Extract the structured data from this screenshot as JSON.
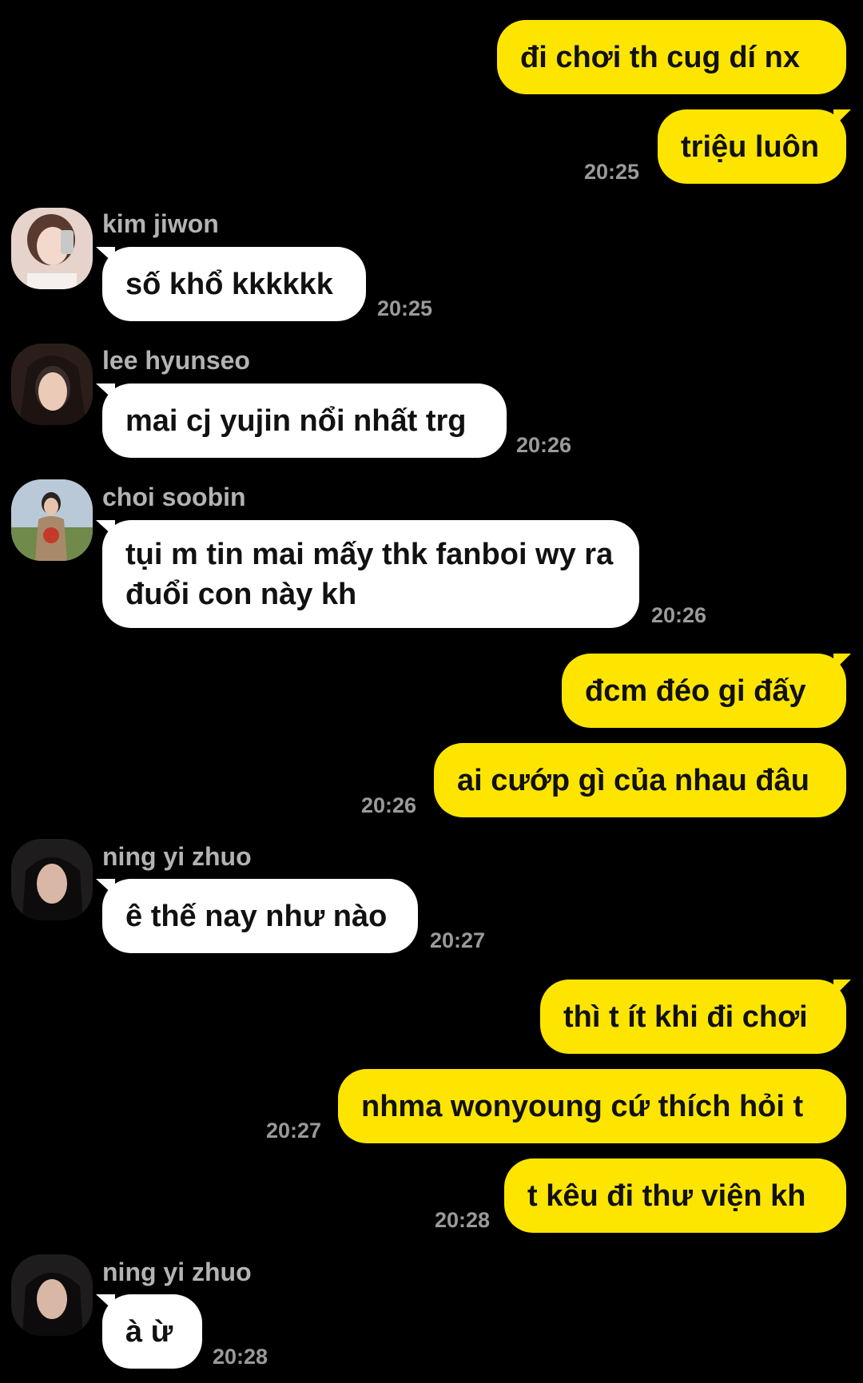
{
  "messages": [
    {
      "from": "me",
      "text": "đi chơi th cug dí nx"
    },
    {
      "from": "me",
      "text": "triệu luôn",
      "time": "20:25"
    },
    {
      "from": "kim jiwon",
      "sender": "kim jiwon",
      "text": "số khổ kkkkkk",
      "time": "20:25"
    },
    {
      "from": "lee hyunseo",
      "sender": "lee hyunseo",
      "text": "mai cj yujin nổi nhất trg",
      "time": "20:26"
    },
    {
      "from": "choi soobin",
      "sender": "choi soobin",
      "text": "tụi m tin mai mấy thk fanboi wy ra đuổi con này kh",
      "time": "20:26"
    },
    {
      "from": "me",
      "text": "đcm đéo gi đấy"
    },
    {
      "from": "me",
      "text": "ai cướp gì của nhau đâu",
      "time": "20:26"
    },
    {
      "from": "ning yi zhuo",
      "sender": "ning yi zhuo",
      "text": "ê thế nay như nào",
      "time": "20:27"
    },
    {
      "from": "me",
      "text": "thì t ít khi đi chơi"
    },
    {
      "from": "me",
      "text": "nhma wonyoung cứ thích hỏi t",
      "time": "20:27"
    },
    {
      "from": "me",
      "text": "t kêu đi thư viện kh",
      "time": "20:28"
    },
    {
      "from": "ning yi zhuo",
      "sender": "ning yi zhuo",
      "text": "à ừ",
      "time": "20:28"
    }
  ],
  "colors": {
    "outgoing_bubble": "#fee500",
    "incoming_bubble": "#ffffff",
    "background": "#000000",
    "timestamp": "#9a9a9a",
    "sender_name": "#b3b3b3"
  }
}
